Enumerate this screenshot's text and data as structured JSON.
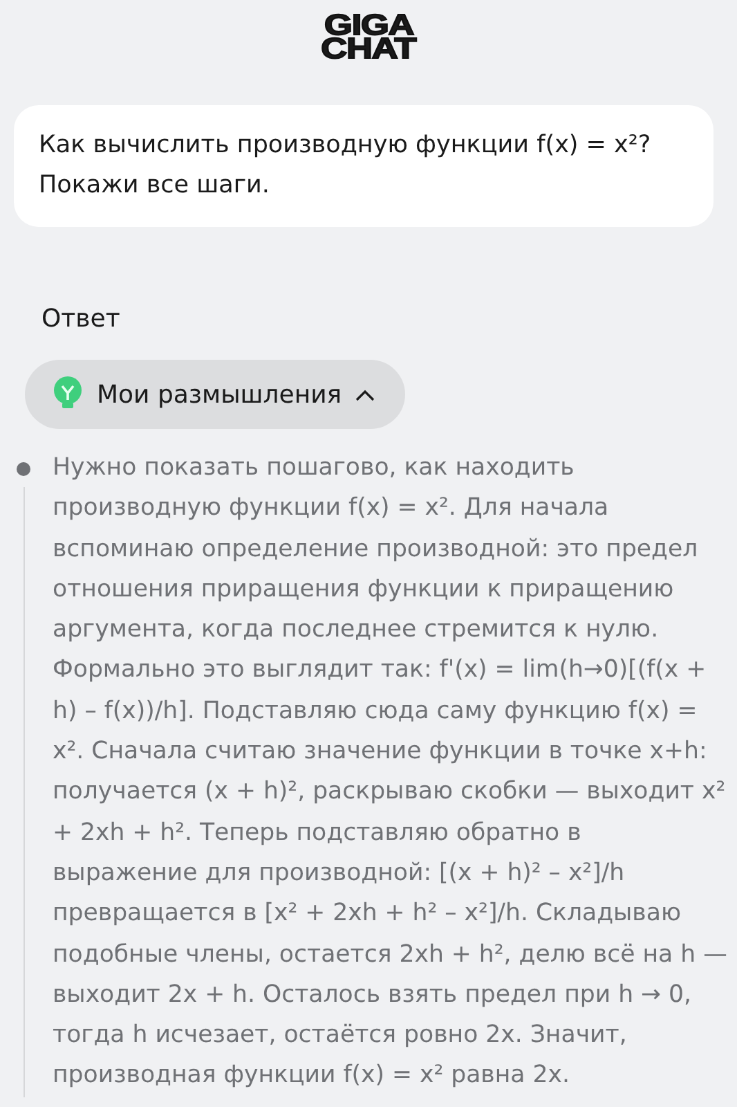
{
  "logo": {
    "line_1": "GIGA",
    "line_2": "CHAT"
  },
  "question": {
    "text": "Как вычислить производную функции f(x) = x²? Покажи все шаги."
  },
  "answer": {
    "heading": "Ответ",
    "thoughts": {
      "label": "Мои размышления",
      "expanded": true,
      "text": "Нужно показать пошагово, как находить производную функции f(x) = x². Для начала вспоминаю определение производной: это предел отношения приращения функции к приращению аргумента, когда последнее стремится к нулю. Формально это выглядит так: f'(x) = lim(h→0)[(f(x + h) – f(x))/h]. Подставляю сюда саму функцию f(x) = x². Сначала считаю значение функции в точке x+h: получается (x + h)², раскрываю скобки — выходит x² + 2xh + h². Теперь подставляю обратно в выражение для производной: [(x + h)² – x²]/h превращается в [x² + 2xh + h² – x²]/h. Складываю подобные члены, остается 2xh + h², делю всё на h — выходит 2x + h. Осталось взять предел при h → 0, тогда h исчезает, остаётся ровно 2x. Значит, производная функции f(x) = x² равна 2x."
    }
  }
}
